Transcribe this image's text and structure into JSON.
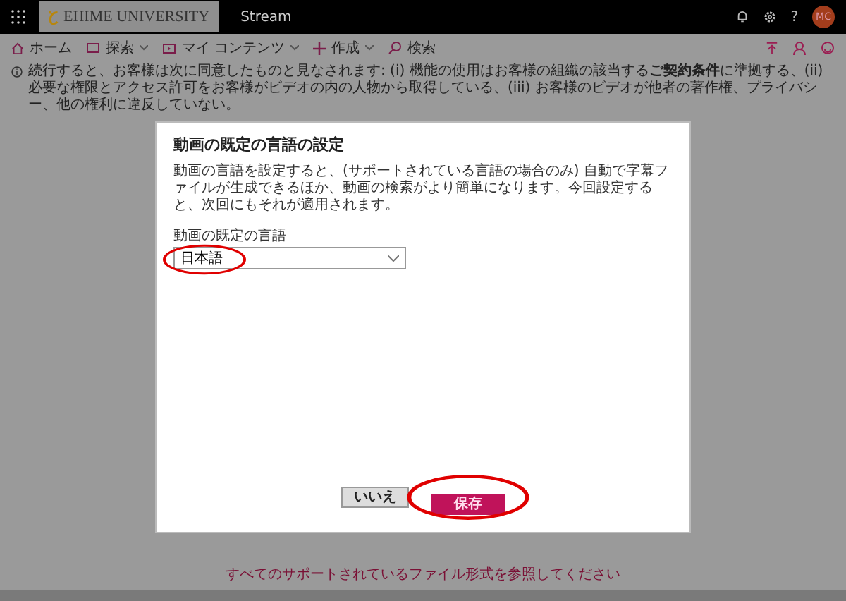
{
  "top_bar": {
    "logo": "EHIME UNIVERSITY",
    "app_name": "Stream",
    "help": "?",
    "avatar": "MC"
  },
  "nav": [
    {
      "label": "ホーム",
      "dropdown": false
    },
    {
      "label": "探索",
      "dropdown": true
    },
    {
      "label": "マイ コンテンツ",
      "dropdown": true
    },
    {
      "label": "作成",
      "dropdown": true
    },
    {
      "label": "検索",
      "dropdown": false
    }
  ],
  "notice": {
    "text": "続行すると、お客様は次に同意したものと見なされます: (i) 機能の使用はお客様の組織の該当する**ご契約条件**に準拠する、(ii) 必要な権限とアクセス許可をお客様がビデオの内の人物から取得している、(iii) お客様のビデオが他者の著作権、プライバシー、他の権利に違反していない。"
  },
  "dialog": {
    "title": "動画の既定の言語の設定",
    "description": "動画の言語を設定すると、(サポートされている言語の場合のみ) 自動で字幕ファイルが生成できるほか、動画の検索がより簡単になります。今回設定すると、次回にもそれが適用されます。",
    "field_label": "動画の既定の言語",
    "field_value": "日本語",
    "buttons": [
      {
        "label": "いいえ",
        "kind": "secondary"
      },
      {
        "label": "保存",
        "kind": "primary"
      }
    ]
  },
  "footer_link": "すべてのサポートされているファイル形式を参照してください"
}
